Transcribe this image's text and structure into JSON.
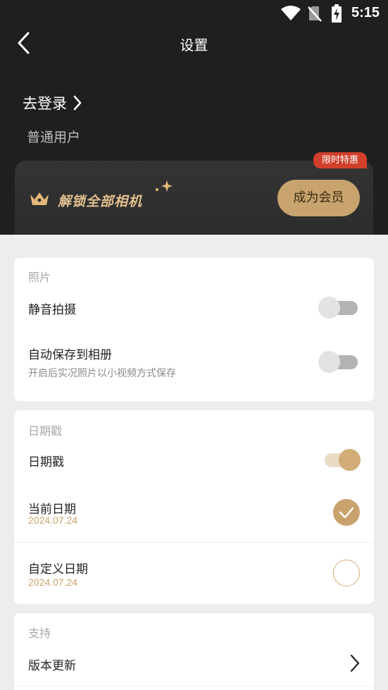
{
  "status_bar": {
    "time": "5:15",
    "icons": [
      "wifi-icon",
      "no-sim-icon",
      "battery-charging-icon"
    ]
  },
  "header": {
    "title": "设置",
    "back_icon": "chevron-left-icon"
  },
  "account": {
    "login_label": "去登录",
    "user_type": "普通用户"
  },
  "vip_banner": {
    "badge": "限时特惠",
    "unlock_text": "解锁全部相机",
    "button_label": "成为会员",
    "accent": "#c8a36d"
  },
  "photos": {
    "section_title": "照片",
    "silent_label": "静音拍摄",
    "silent_enabled": false,
    "autosave_label": "自动保存到相册",
    "autosave_desc": "开启后实况照片以小视频方式保存",
    "autosave_enabled": false
  },
  "datestamp": {
    "section_title": "日期戳",
    "toggle_label": "日期戳",
    "toggle_enabled": true,
    "current_label": "当前日期",
    "current_value": "2024.07.24",
    "current_selected": true,
    "custom_label": "自定义日期",
    "custom_value": "2024.07.24",
    "custom_selected": false
  },
  "support": {
    "section_title": "支持",
    "update_label": "版本更新"
  }
}
